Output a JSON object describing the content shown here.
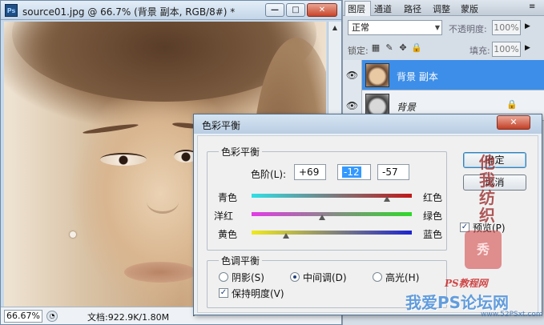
{
  "document": {
    "app_icon": "Ps",
    "title": "source01.jpg @ 66.7% (背景 副本, RGB/8#) *",
    "controls": {
      "minimize": "—",
      "maximize": "□",
      "close": "✕"
    },
    "zoom": "66.67%",
    "doc_info": "文档:922.9K/1.80M",
    "status_arrow": "►",
    "scroll_up": "▲"
  },
  "layers_panel": {
    "tabs": [
      "图层",
      "通道",
      "路径",
      "调整",
      "蒙版"
    ],
    "menu_icon": "≡",
    "blend_mode": "正常",
    "blend_arrow": "▼",
    "opacity_label": "不透明度:",
    "opacity_value": "100%",
    "lock_label": "锁定:",
    "fill_label": "填充:",
    "fill_value": "100%",
    "spin_arrow": "▶",
    "lock_icons": [
      "▦",
      "✎",
      "✥",
      "🔒"
    ],
    "layers": [
      {
        "name": "背景 副本",
        "visible_glyph": "👁",
        "selected": true
      },
      {
        "name": "背景",
        "visible_glyph": "👁",
        "selected": false,
        "locked_glyph": "🔒"
      }
    ]
  },
  "dialog": {
    "title": "色彩平衡",
    "close": "✕",
    "balance_group": "色彩平衡",
    "levels_label": "色阶(L):",
    "levels": [
      "+69",
      "-12",
      "-57"
    ],
    "sliders": [
      {
        "left": "青色",
        "right": "红色",
        "value": 69
      },
      {
        "left": "洋红",
        "right": "绿色",
        "value": -12
      },
      {
        "left": "黄色",
        "right": "蓝色",
        "value": -57
      }
    ],
    "tone_group": "色调平衡",
    "tones": [
      "阴影(S)",
      "中间调(D)",
      "高光(H)"
    ],
    "selected_tone": 1,
    "preserve_luminosity": "保持明度(V)",
    "preview": "预览(P)",
    "ok": "确定",
    "cancel": "取消",
    "check_glyph": "✓"
  },
  "watermark": {
    "vertical": "他我纺织",
    "seal": "秀",
    "site": "PS教程网",
    "big": "我爱PS论坛网",
    "url": "www.52PSxt.com"
  }
}
